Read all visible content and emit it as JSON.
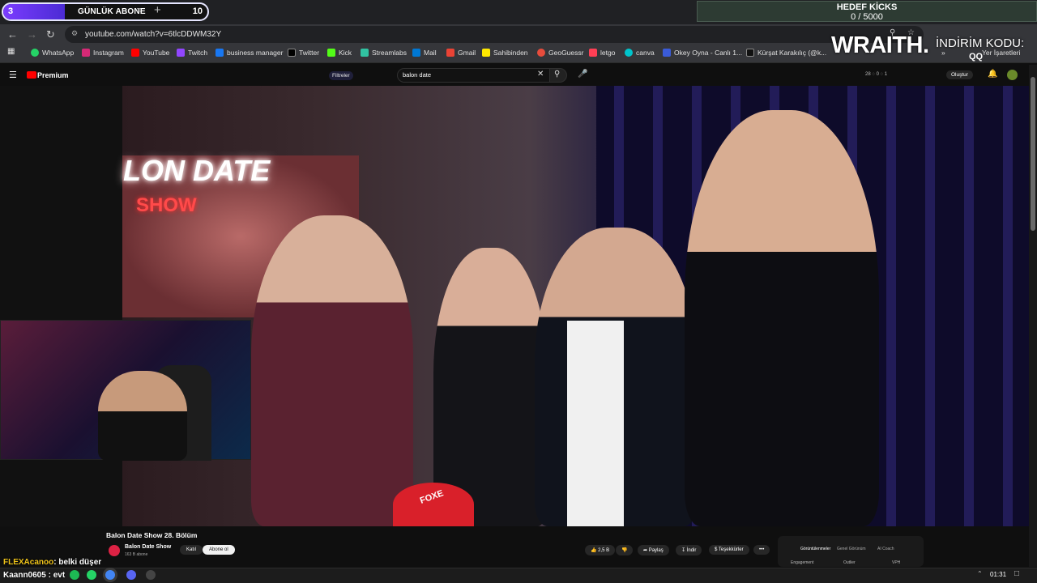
{
  "overlay": {
    "abone_left": "3",
    "abone_title": "GÜNLÜK ABONE",
    "abone_right": "10",
    "abone_progress": 0.3,
    "hedef_title": "HEDEF KİCKS",
    "hedef_progress": "0 / 5000",
    "wraith": "WRAITH.",
    "indirim": "İNDİRİM KODU:",
    "code": "QQ"
  },
  "browser": {
    "url": "youtube.com/watch?v=6tlcDDWM32Y",
    "tab_close": "×",
    "new_tab": "+",
    "bookmarks": [
      "WhatsApp",
      "Instagram",
      "YouTube",
      "Twitch",
      "business manager",
      "Twitter",
      "Kick",
      "Streamlabs",
      "Mail",
      "Gmail",
      "Sahibinden",
      "GeoGuessr",
      "letgo",
      "canva",
      "Okey Oyna - Canlı 1...",
      "Kürşat Karakılıç (@k..."
    ],
    "bookmarks_overflow": "Yer İşaretleri"
  },
  "youtube": {
    "logo": "Premium",
    "filters": "Filtreler",
    "search_value": "balon date",
    "header_counts": "28 ◌ 0 ◌ 1",
    "create": "Oluştur",
    "video_title": "Balon Date Show 28. Bölüm",
    "channel": "Balon Date Show",
    "subscribers": "163 B abone",
    "join": "Katıl",
    "subscribe": "Abone ol",
    "likes": "2,5 B",
    "share": "Paylaş",
    "download": "İndir",
    "thanks": "Teşekkürler",
    "more": "•••",
    "neon_line1": "LON DATE",
    "neon_line2": "SHOW",
    "balloon_text": "FOXE",
    "stats_tabs": [
      "Görüntülenmeler",
      "Genel Görünüm",
      "AI Coach"
    ],
    "stats_cols": [
      "Engagement",
      "Outlier",
      "VPH"
    ]
  },
  "chat": {
    "user1": "FLEXAcanoo",
    "msg1": ": belki düşer",
    "line2": "Kaann0605 : evt"
  },
  "taskbar": {
    "time": "01:31"
  }
}
